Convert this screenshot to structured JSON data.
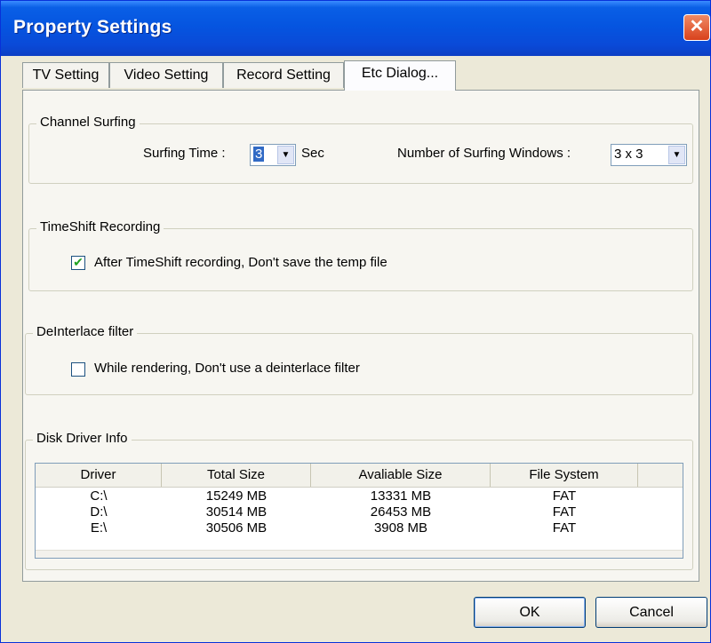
{
  "window": {
    "title": "Property Settings",
    "close_glyph": "✕"
  },
  "tabs": [
    "TV Setting",
    "Video Setting",
    "Record Setting",
    "Etc Dialog..."
  ],
  "active_tab": "Etc Dialog...",
  "channel_surfing": {
    "label": "Channel Surfing",
    "surfing_time_label": "Surfing Time :",
    "surfing_time_value": "3",
    "unit": "Sec",
    "windows_label": "Number of Surfing Windows :",
    "windows_value": "3 x 3"
  },
  "timeshift": {
    "label": "TimeShift Recording",
    "checkbox_label": "After TimeShift recording, Don't save the temp file",
    "checked": true
  },
  "deinterlace": {
    "label": "DeInterlace filter",
    "checkbox_label": "While rendering, Don't use a deinterlace filter",
    "checked": false
  },
  "disk_info": {
    "label": "Disk Driver Info",
    "columns": [
      "Driver",
      "Total Size",
      "Avaliable Size",
      "File System"
    ],
    "rows": [
      [
        "C:\\",
        "15249 MB",
        "13331 MB",
        "FAT"
      ],
      [
        "D:\\",
        "30514 MB",
        "26453 MB",
        "FAT"
      ],
      [
        "E:\\",
        "30506 MB",
        "3908 MB",
        "FAT"
      ]
    ]
  },
  "buttons": {
    "ok": "OK",
    "cancel": "Cancel"
  },
  "icons": {
    "dropdown": "▼",
    "check": "✔"
  }
}
